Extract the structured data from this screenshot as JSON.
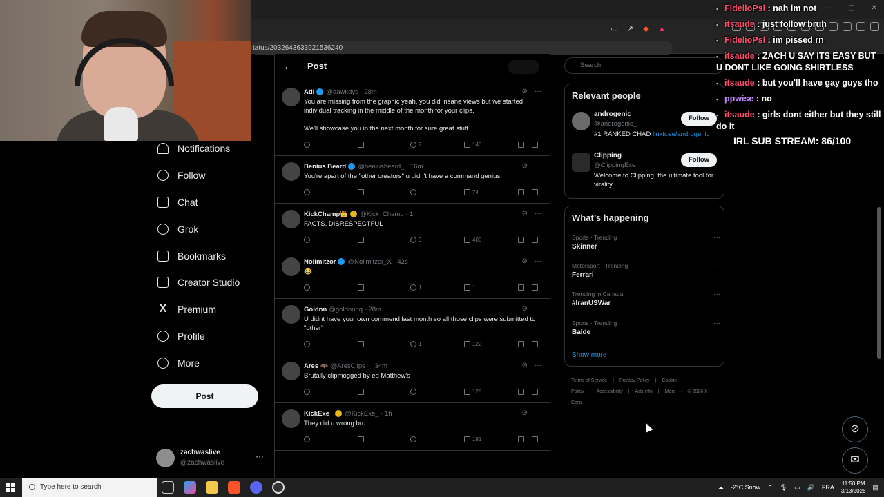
{
  "browser": {
    "url": "tatus/2032643633921536240"
  },
  "chat": [
    {
      "user": "FidelioPsl",
      "text": " : nah im not",
      "color": "#ff4d6d"
    },
    {
      "user": "itsaude",
      "text": " : just follow bruh",
      "color": "#ff4d6d"
    },
    {
      "user": "FidelioPsl",
      "text": " : im pissed rn",
      "color": "#ff4d6d"
    },
    {
      "user": "itsaude",
      "text": " : ZACH U SAY ITS EASY BUT U DONT LIKE GOING SHIRTLESS",
      "color": "#ff4d6d"
    },
    {
      "user": "itsaude",
      "text": " : but you'll have gay guys tho",
      "color": "#ff4d6d"
    },
    {
      "user": "ppwise",
      "text": " : no",
      "color": "#c18bff"
    },
    {
      "user": "itsaude",
      "text": " : girls dont either but they still do it",
      "color": "#ff4d6d"
    }
  ],
  "sub_goal": "IRL SUB STREAM: 86/100",
  "nav": [
    {
      "label": "Notifications",
      "icon": "bell-icon"
    },
    {
      "label": "Follow",
      "icon": "person-plus-icon"
    },
    {
      "label": "Chat",
      "icon": "mail-icon"
    },
    {
      "label": "Grok",
      "icon": "grok-icon"
    },
    {
      "label": "Bookmarks",
      "icon": "bookmark-icon"
    },
    {
      "label": "Creator Studio",
      "icon": "rocket-icon"
    },
    {
      "label": "Premium",
      "icon": "x-logo-icon"
    },
    {
      "label": "Profile",
      "icon": "person-icon"
    },
    {
      "label": "More",
      "icon": "more-circle-icon"
    }
  ],
  "post_button": "Post",
  "account": {
    "name": "zachwaslive",
    "handle": "@zachwaslive",
    "more": "···"
  },
  "header": {
    "back": "←",
    "title": "Post"
  },
  "replies": [
    {
      "name": "Adi",
      "handle": "@aawkdys",
      "time": "· 28m",
      "verified": "blue",
      "text": "You are missing from the graphic yeah, you did insane views but we started individual tracking in the middle of the month for your clips.\n\nWe'll showcase you in the next month for sure great stuff",
      "likes": "2",
      "views": "140"
    },
    {
      "name": "Benius Beard",
      "handle": "@beniusbeard_",
      "time": "· 16m",
      "verified": "blue",
      "text": "You're apart of the \"other creators\" u didn't have a command genius",
      "likes": "",
      "views": "74"
    },
    {
      "name": "KickChamp👑",
      "handle": "@Kick_Champ",
      "time": "· 1h",
      "verified": "gold",
      "text": "FACTS. DISRESPECTFUL",
      "likes": "9",
      "views": "400"
    },
    {
      "name": "Nolimitzor",
      "handle": "@Nolimitzor_X",
      "time": "· 42s",
      "verified": "blue",
      "text": "😂",
      "likes": "1",
      "views": "1"
    },
    {
      "name": "Goldnn",
      "handle": "@goldnnhq",
      "time": "· 28m",
      "verified": "",
      "text": "U didnt have your own commend last month so all those clips were submitted to \"other\"",
      "likes": "1",
      "views": "122"
    },
    {
      "name": "Ares 🦇",
      "handle": "@AresClips_",
      "time": "· 34m",
      "verified": "",
      "text": "Brutally clipmogged by ed Matthew's",
      "likes": "",
      "views": "128"
    },
    {
      "name": "KickExe_",
      "handle": "@KickExe_",
      "time": "· 1h",
      "verified": "gold",
      "text": "They did u wrong bro",
      "likes": "",
      "views": "181"
    }
  ],
  "search": {
    "placeholder": "Search"
  },
  "relevant_people": {
    "title": "Relevant people",
    "people": [
      {
        "name": "androgenic",
        "handle": "@androgenic_",
        "bio": "#1 RANKED CHAD ",
        "link": "linktr.ee/androgenic",
        "button": "Follow"
      },
      {
        "name": "Clipping",
        "handle": "@ClippingExe",
        "bio": "Welcome to Clipping, the ultimate tool for virality.",
        "link": "",
        "button": "Follow"
      }
    ]
  },
  "trends": {
    "title": "What’s happening",
    "items": [
      {
        "meta": "Sports · Trending",
        "name": "Skinner"
      },
      {
        "meta": "Motorsport · Trending",
        "name": "Ferrari"
      },
      {
        "meta": "Trending in Canada",
        "name": "#IranUSWar"
      },
      {
        "meta": "Sports · Trending",
        "name": "Balde"
      }
    ],
    "show_more": "Show more"
  },
  "footer": [
    "Terms of Service",
    "|",
    "Privacy Policy",
    "|",
    "Cookie Policy",
    "|",
    "Accessibility",
    "|",
    "Ads info",
    "|",
    "More ···",
    "© 2026 X Corp."
  ],
  "taskbar": {
    "search_placeholder": "Type here to search",
    "weather": "-2°C  Snow",
    "lang": "FRA",
    "time": "11:50 PM",
    "date": "3/13/2026"
  }
}
